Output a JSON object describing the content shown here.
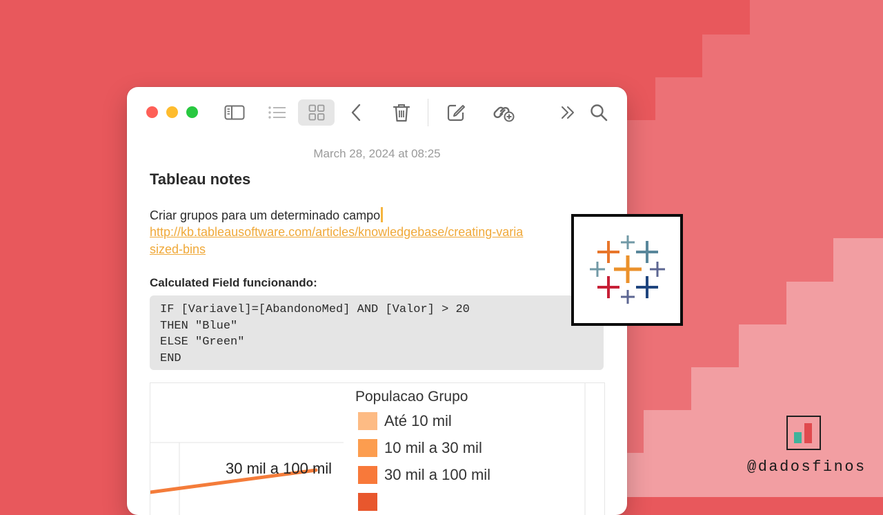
{
  "theme": {
    "background": "#e8585c",
    "link_color": "#f0a93a",
    "traffic_lights": [
      "#fe5f57",
      "#febc2e",
      "#28c840"
    ]
  },
  "toolbar": {
    "icons": [
      "sidebar-icon",
      "list-view-icon",
      "gallery-view-icon",
      "back-icon",
      "trash-icon",
      "compose-icon",
      "share-link-icon",
      "more-icon",
      "search-icon"
    ]
  },
  "note": {
    "date": "March 28, 2024 at 08:25",
    "title": "Tableau notes",
    "paragraph": "Criar grupos para um determinado campo",
    "link_line1": "http://kb.tableausoftware.com/articles/knowledgebase/creating-varia",
    "link_line2": "sized-bins",
    "subheading": "Calculated Field funcionando:",
    "code": [
      "IF [Variavel]=[AbandonoMed] AND [Valor] > 20",
      "THEN \"Blue\"",
      "ELSE \"Green\"",
      "END"
    ]
  },
  "embedded_image": {
    "legend_title": "Populacao Grupo",
    "legend": [
      {
        "label": "Até 10 mil",
        "color": "#fdbb84"
      },
      {
        "label": "10 mil a 30 mil",
        "color": "#fc9d4f"
      },
      {
        "label": "30 mil a 100 mil",
        "color": "#f8793a"
      },
      {
        "label": "",
        "color": "#e8572d"
      }
    ],
    "line_label": "30 mil a 100 mil",
    "line_color": "#f47c3a"
  },
  "logo": {
    "name": "tableau-logo-icon",
    "colors": [
      "#e8762b",
      "#5b879b",
      "#eb912b",
      "#59879b",
      "#7199a6",
      "#c72037",
      "#1f457e",
      "#5c6692"
    ]
  },
  "branding": {
    "handle": "@dadosfinos",
    "icon_colors": [
      "#3fb39b",
      "#e04a4e"
    ]
  }
}
